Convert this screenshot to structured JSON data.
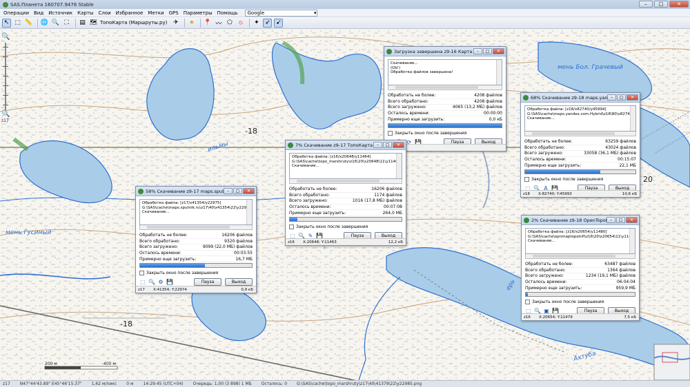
{
  "app": {
    "title": "SAS.Планета 160707.9476 Stable",
    "window_buttons": [
      "–",
      "□",
      "✕"
    ]
  },
  "menu": {
    "items": [
      "Операции",
      "Вид",
      "Источник",
      "Карты",
      "Слои",
      "Избранное",
      "Метки",
      "GPS",
      "Параметры",
      "Помощь"
    ],
    "search_provider": "Google"
  },
  "toolbar": {
    "map_label": "ТопоКарта (Маршруты.ру)"
  },
  "zoom": {
    "label": "z17"
  },
  "map": {
    "labels": [
      "-18",
      "-18",
      "20",
      "20",
      "-18"
    ],
    "scale_left": "200 м",
    "scale_right": "400 м",
    "river_labels": [
      "мень Гусиный",
      "мень Бол. Грачевый",
      "ильмы",
      "Ахтуба",
      "ерь"
    ]
  },
  "dialogs": [
    {
      "id": "done",
      "title": "Загрузка завершена z9-16 Карта ...",
      "log": "Скачивание...\n(Ok!)\nОбработка файлов завершена!",
      "rows": [
        {
          "label": "Обработать не более:",
          "value": "4208 файлов"
        },
        {
          "label": "Всего обработано:",
          "value": "4208 файлов"
        },
        {
          "label": "Всего загружено:",
          "value": "4065 (13,2 МБ) файлов"
        },
        {
          "label": "Осталось времени:",
          "value": "00:00:00"
        },
        {
          "label": "Примерно еще загрузить:",
          "value": "0,0 кБ"
        }
      ],
      "progress": 1.0,
      "checkbox": "Закрыть окно после завершения",
      "pause": "Пауза",
      "exit": "Выход",
      "foot_zoom": "z16",
      "foot_coords": "",
      "foot_speed": ""
    },
    {
      "id": "yandex",
      "title": "68% Скачивание z9-18 maps.yand...",
      "log": "Обработка файла: [z18/x82740/y45994]\nG:\\SAS\\cache\\maps.yandex.com.Hybrid\\z18\\80\\x82740\\4\nСкачивание...",
      "rows": [
        {
          "label": "Обработать не более:",
          "value": "63259 файлов"
        },
        {
          "label": "Всего обработано:",
          "value": "43024 файлов"
        },
        {
          "label": "Всего загружено:",
          "value": "33058 (36,1 МБ) файлов"
        },
        {
          "label": "Осталось времени:",
          "value": "00:15:07"
        },
        {
          "label": "Примерно еще загрузить:",
          "value": "22,1 МБ"
        }
      ],
      "progress": 0.68,
      "checkbox": "Закрыть окно после завершения",
      "pause": "Пауза",
      "exit": "Выход",
      "foot_zoom": "z18",
      "foot_coords": "X:82740; Y:45993",
      "foot_speed": "10,6 кБ"
    },
    {
      "id": "topo",
      "title": "7% Скачивание z9-17 ТопоКарта (...",
      "log": "Обработка файла: [z16/x20648/y11464]\nG:\\SAS\\cache\\topo_marshruty\\z16\\20\\x20648\\11\\y11464.\nСкачивание...",
      "rows": [
        {
          "label": "Обработать не более:",
          "value": "16206 файлов"
        },
        {
          "label": "Всего обработано:",
          "value": "1174 файлов"
        },
        {
          "label": "Всего загружено:",
          "value": "1016 (17,8 МБ) файлов"
        },
        {
          "label": "Осталось времени:",
          "value": "00:07:08"
        },
        {
          "label": "Примерно еще загрузить:",
          "value": "264,0 МБ"
        }
      ],
      "progress": 0.07,
      "checkbox": "Закрыть окно после завершения",
      "pause": "Пауза",
      "exit": "Выход",
      "foot_zoom": "z16",
      "foot_coords": "X:20648; Y:11463",
      "foot_speed": "12,2 кБ"
    },
    {
      "id": "sputnik",
      "title": "58% Скачивание z9-17 maps.sputnik...",
      "log": "Обработка файла: [z17/x41354/y22975]\nG:\\SAS\\cache\\maps.sputnik.ru\\z17\\40\\x41354\\22\\y22975.\nСкачивание...",
      "rows": [
        {
          "label": "Обработать не более:",
          "value": "16206 файлов"
        },
        {
          "label": "Всего обработано:",
          "value": "9320 файлов"
        },
        {
          "label": "Всего загружено:",
          "value": "9099 (22,0 МБ) файлов"
        },
        {
          "label": "Осталось времени:",
          "value": "00:03:55"
        },
        {
          "label": "Примерно еще загрузить:",
          "value": "16,7 МБ"
        }
      ],
      "progress": 0.58,
      "checkbox": "Закрыть окно после завершения",
      "pause": "Пауза",
      "exit": "Выход",
      "foot_zoom": "z17",
      "foot_coords": "X:41354; Y:22974",
      "foot_speed": "0,9 кБ"
    },
    {
      "id": "otm",
      "title": "2% Скачивание z9-18 OpenTopoM...",
      "log": "Обработка файла: [z16/x20654/y11480]\nG:\\SAS\\cache\\opnmaptopoinfi\\z16\\20\\x20654\\11\\y11480.p\nСкачивание...",
      "rows": [
        {
          "label": "Обработать не более:",
          "value": "63487 файлов"
        },
        {
          "label": "Всего обработано:",
          "value": "1364 файлов"
        },
        {
          "label": "Всего загружено:",
          "value": "1234 (19,1 МБ) файлов"
        },
        {
          "label": "Осталось времени:",
          "value": "06:04:04"
        },
        {
          "label": "Примерно еще загрузить:",
          "value": "959,9 МБ"
        }
      ],
      "progress": 0.02,
      "checkbox": "Закрыть окно после завершения",
      "pause": "Пауза",
      "exit": "Выход",
      "foot_zoom": "z16",
      "foot_coords": "X:20654; Y:11479",
      "foot_speed": "7,5 кБ"
    }
  ],
  "status": {
    "zoom": "z17",
    "coords": "N47°44'43.89\" E45°46'15.37\"",
    "scale": "1,62 м/пикс",
    "alt": "0 м",
    "time": "14:29:45 (UTC+04)",
    "queue": "Очередь: 1,00 (3 898) 1 МБ",
    "remaining": "Осталось: 0",
    "path": "G:\\SAS\\cache\\topo_marshruty\\z17\\40\\41379\\22\\y22985.png"
  }
}
